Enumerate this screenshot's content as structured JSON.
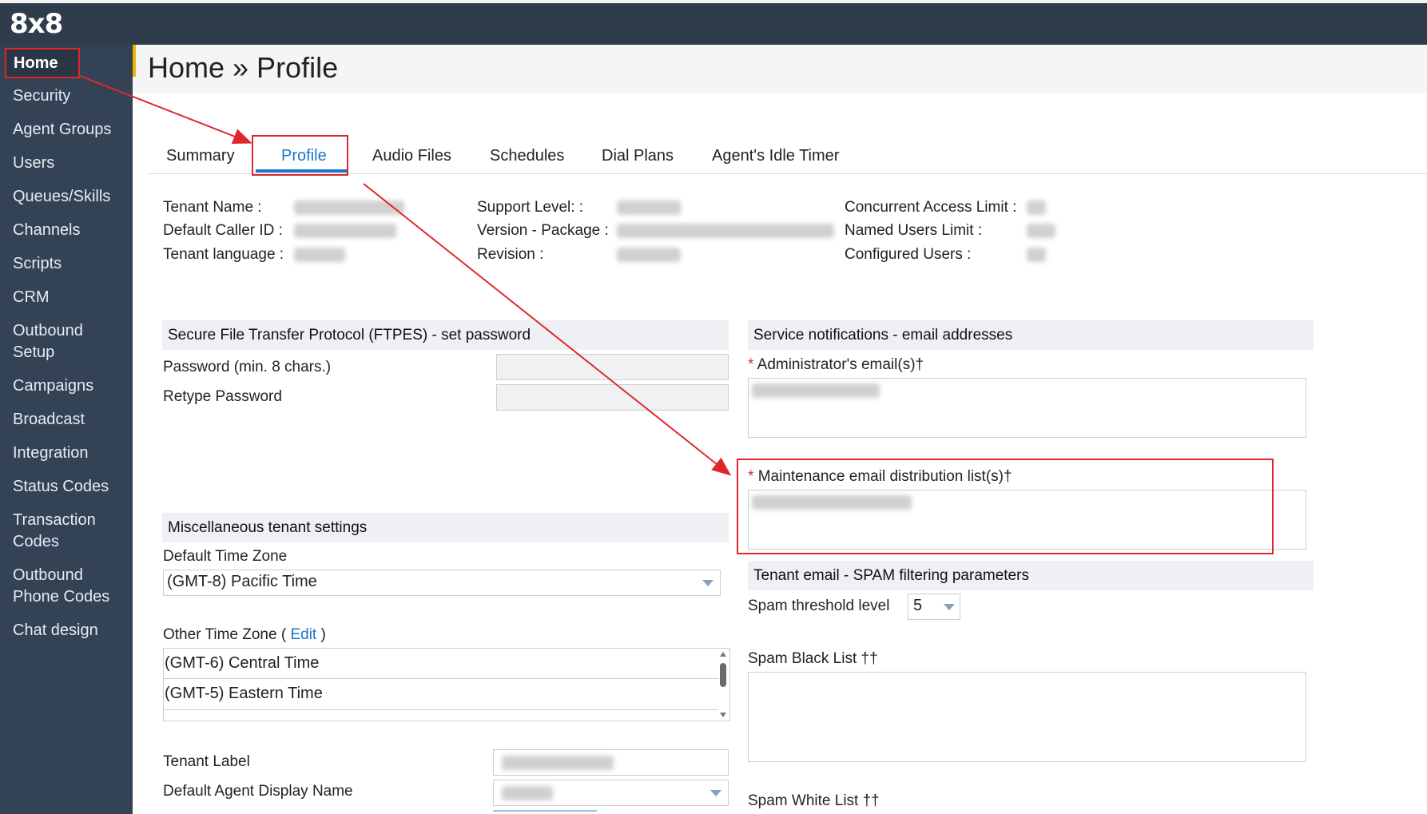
{
  "app": {
    "logo": "8x8"
  },
  "sidebar": {
    "items": [
      {
        "label": "Home"
      },
      {
        "label": "Security"
      },
      {
        "label": "Agent Groups"
      },
      {
        "label": "Users"
      },
      {
        "label": "Queues/Skills"
      },
      {
        "label": "Channels"
      },
      {
        "label": "Scripts"
      },
      {
        "label": "CRM"
      },
      {
        "label": "Outbound",
        "label2": "Setup"
      },
      {
        "label": "Campaigns"
      },
      {
        "label": "Broadcast"
      },
      {
        "label": "Integration"
      },
      {
        "label": "Status Codes"
      },
      {
        "label": "Transaction",
        "label2": "Codes"
      },
      {
        "label": "Outbound",
        "label2": "Phone Codes"
      },
      {
        "label": "Chat design"
      }
    ]
  },
  "header": {
    "title": "Home » Profile"
  },
  "tabs": [
    {
      "label": "Summary"
    },
    {
      "label": "Profile"
    },
    {
      "label": "Audio Files"
    },
    {
      "label": "Schedules"
    },
    {
      "label": "Dial Plans"
    },
    {
      "label": "Agent's Idle Timer"
    }
  ],
  "info": {
    "tenant_name": "Tenant Name :",
    "default_caller_id": "Default Caller ID :",
    "tenant_language": "Tenant language :",
    "support_level": "Support Level:  :",
    "version_package": "Version - Package :",
    "revision": "Revision :",
    "concurrent_access_limit": "Concurrent Access Limit :",
    "named_users_limit": "Named Users Limit :",
    "configured_users": "Configured Users :"
  },
  "ftpes": {
    "title": "Secure File Transfer Protocol (FTPES) - set password",
    "password_label": "Password (min. 8 chars.)",
    "retype_label": "Retype Password"
  },
  "notifications": {
    "title": "Service notifications - email addresses",
    "admin_label": "Administrator's email(s)†",
    "maint_label": "Maintenance email distribution list(s)†",
    "required_mark": "*"
  },
  "misc": {
    "title": "Miscellaneous tenant settings",
    "default_tz_label": "Default Time Zone",
    "default_tz_value": "(GMT-8) Pacific Time",
    "other_tz_label": "Other Time Zone (",
    "other_tz_edit": "Edit",
    "other_tz_close": ")",
    "other_tz_items": [
      "(GMT-6) Central Time",
      "(GMT-5) Eastern Time"
    ],
    "tenant_label": "Tenant Label",
    "agent_display_label": "Default Agent Display Name"
  },
  "spam": {
    "title": "Tenant email - SPAM filtering parameters",
    "threshold_label": "Spam threshold level",
    "threshold_value": "5",
    "black_list_label": "Spam Black List ††",
    "white_list_label": "Spam White List ††"
  },
  "colors": {
    "sidebar_bg": "#344256",
    "topbar_bg": "#2f3c4c",
    "accent_blue": "#1a76c8",
    "annotation_red": "#e0262d"
  }
}
